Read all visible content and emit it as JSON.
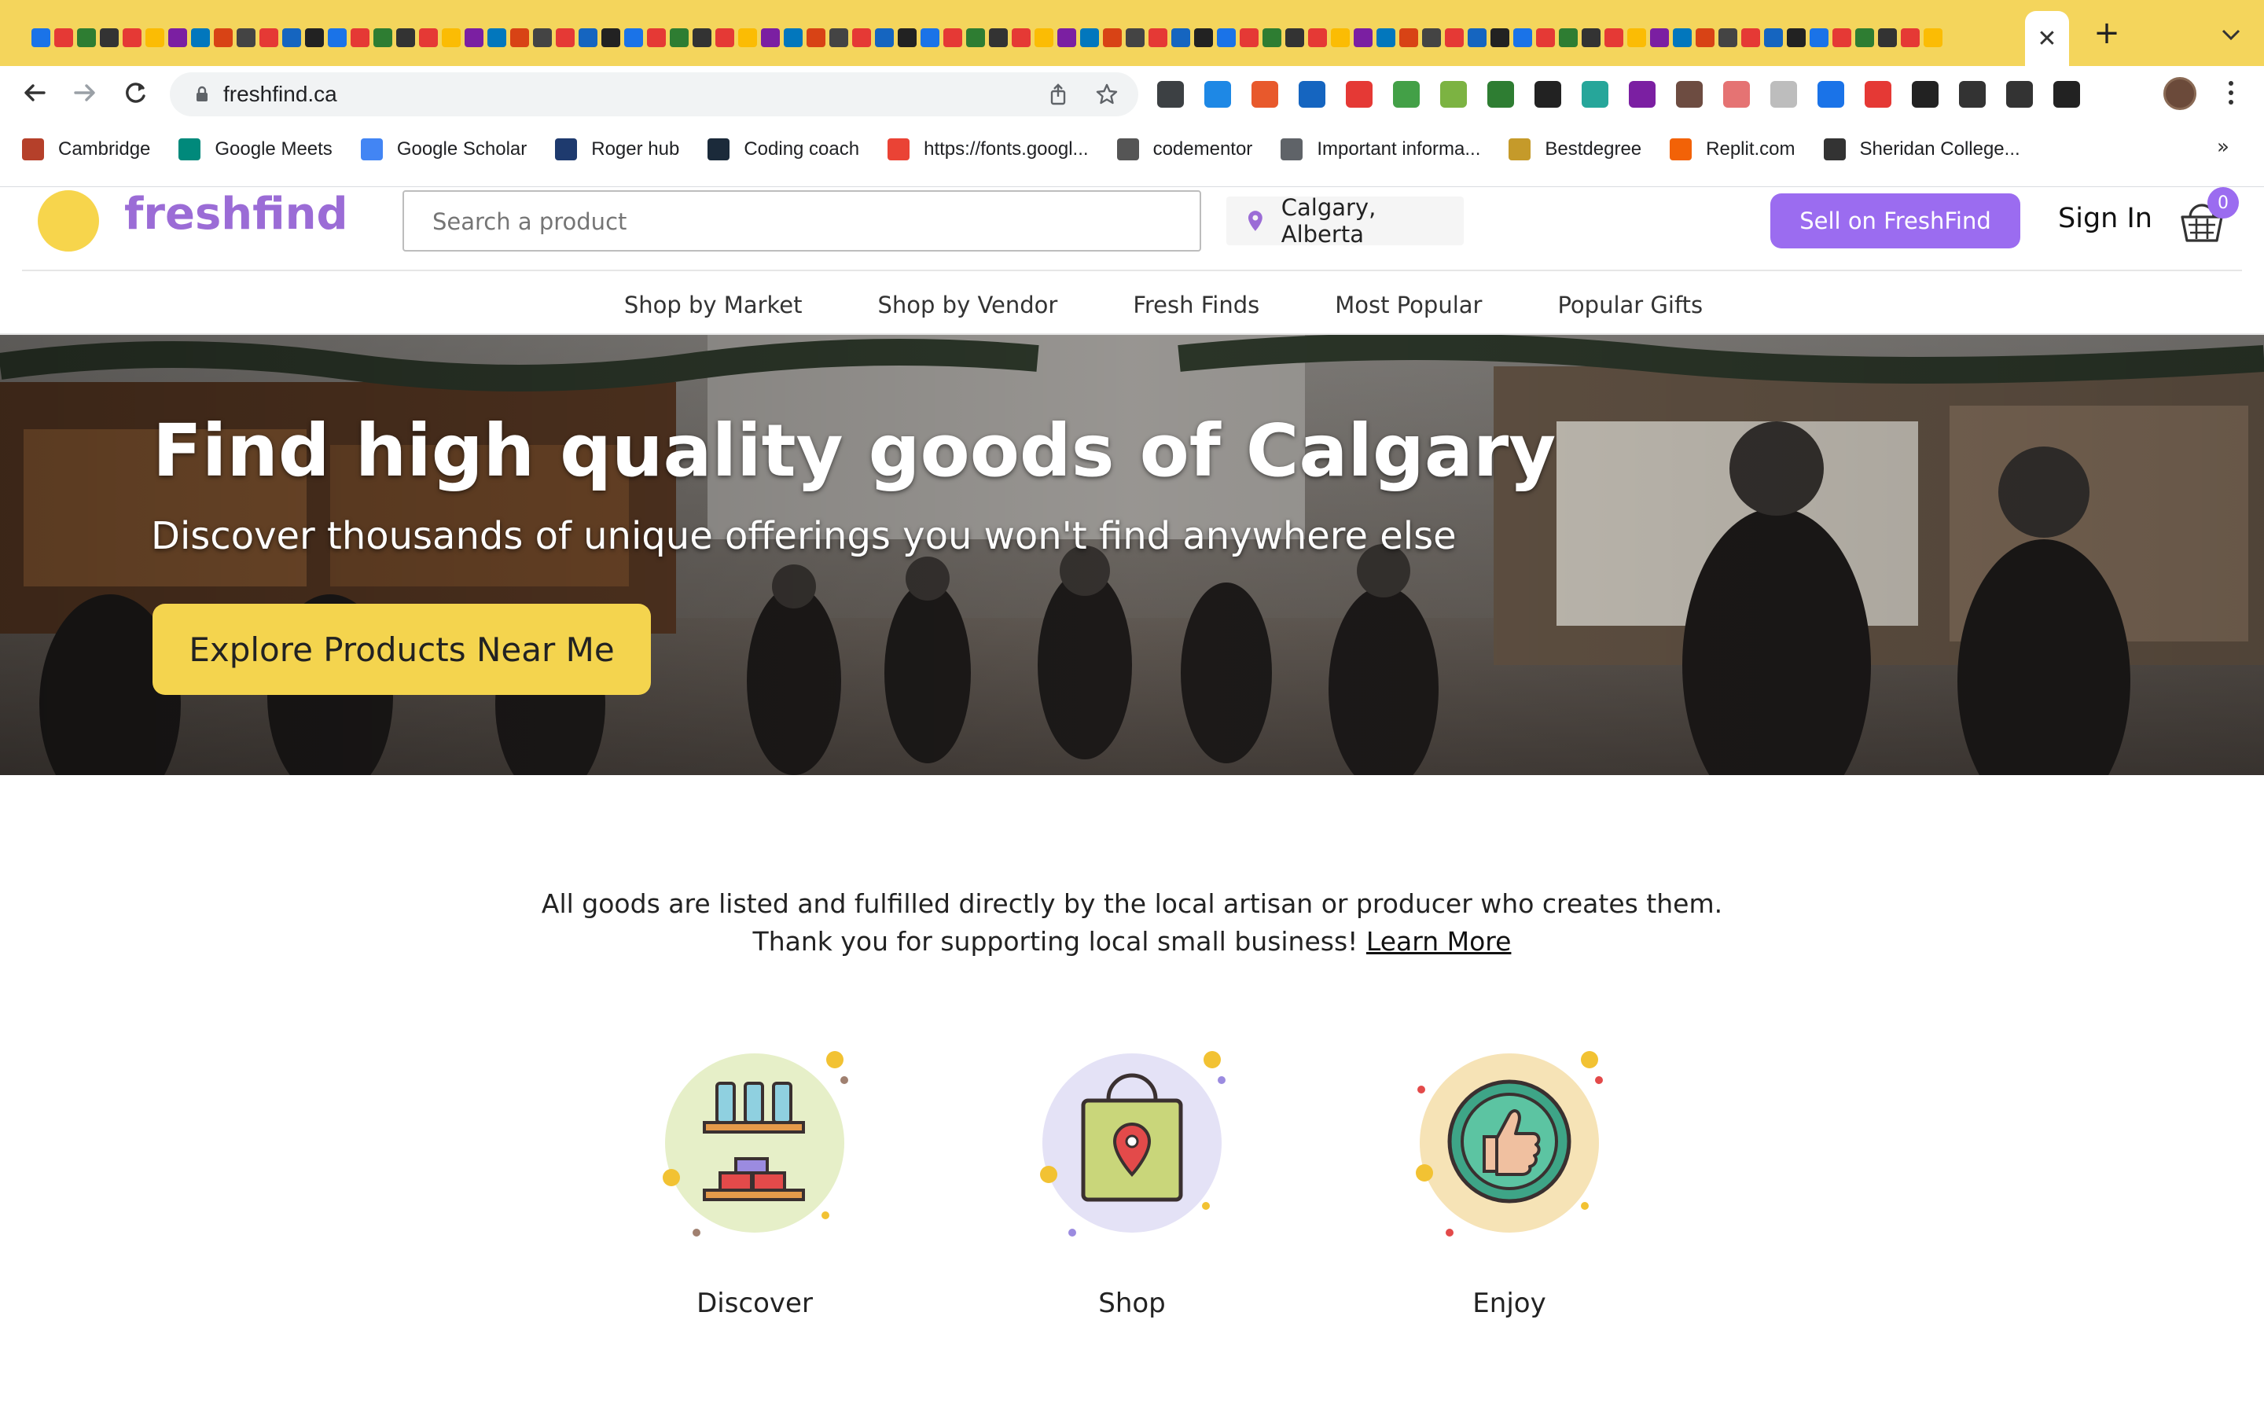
{
  "browser": {
    "url": "freshfind.ca",
    "active_tab_close": "✕",
    "new_tab": "+",
    "bookmarks": [
      {
        "label": "Cambridge",
        "icon": "cambridge-shield-icon",
        "color": "#b5402a"
      },
      {
        "label": "Google Meets",
        "icon": "google-meet-icon",
        "color": "#00897b"
      },
      {
        "label": "Google Scholar",
        "icon": "google-scholar-icon",
        "color": "#4285f4"
      },
      {
        "label": "Roger hub",
        "icon": "roger-hub-icon",
        "color": "#1e3a6e"
      },
      {
        "label": "Coding coach",
        "icon": "coding-coach-icon",
        "color": "#1b2a3a"
      },
      {
        "label": "https://fonts.googl...",
        "icon": "google-fonts-icon",
        "color": "#ea4335"
      },
      {
        "label": "codementor",
        "icon": "codementor-icon",
        "color": "#555555"
      },
      {
        "label": "Important informa...",
        "icon": "folder-icon",
        "color": "#5f6368"
      },
      {
        "label": "Bestdegree",
        "icon": "bestdegree-icon",
        "color": "#c59a2a"
      },
      {
        "label": "Replit.com",
        "icon": "replit-icon",
        "color": "#f26207"
      },
      {
        "label": "Sheridan College...",
        "icon": "sheridan-icon",
        "color": "#333333"
      }
    ],
    "bookmarks_more": "»"
  },
  "site": {
    "logo_text": "freshfind",
    "search_placeholder": "Search a product",
    "location": "Calgary, Alberta",
    "sell_button": "Sell on FreshFind",
    "sign_in": "Sign In",
    "cart_count": "0",
    "nav": [
      "Shop by Market",
      "Shop by Vendor",
      "Fresh Finds",
      "Most Popular",
      "Popular Gifts"
    ]
  },
  "hero": {
    "title": "Find high quality goods of Calgary",
    "subtitle": "Discover thousands of unique offerings you won't find anywhere else",
    "cta": "Explore Products Near Me"
  },
  "info": {
    "line1": "All goods are listed and fulfilled directly by the local artisan or producer who creates them.",
    "line2": "Thank you for supporting local small business!",
    "link": "Learn More"
  },
  "features": [
    {
      "label": "Discover",
      "icon": "shelf-bottles-icon"
    },
    {
      "label": "Shop",
      "icon": "shopping-bag-pin-icon"
    },
    {
      "label": "Enjoy",
      "icon": "thumbs-up-icon"
    }
  ],
  "colors": {
    "brand_purple": "#9b6cf0",
    "brand_yellow": "#f4d44e",
    "tabstrip": "#f4d55c"
  }
}
